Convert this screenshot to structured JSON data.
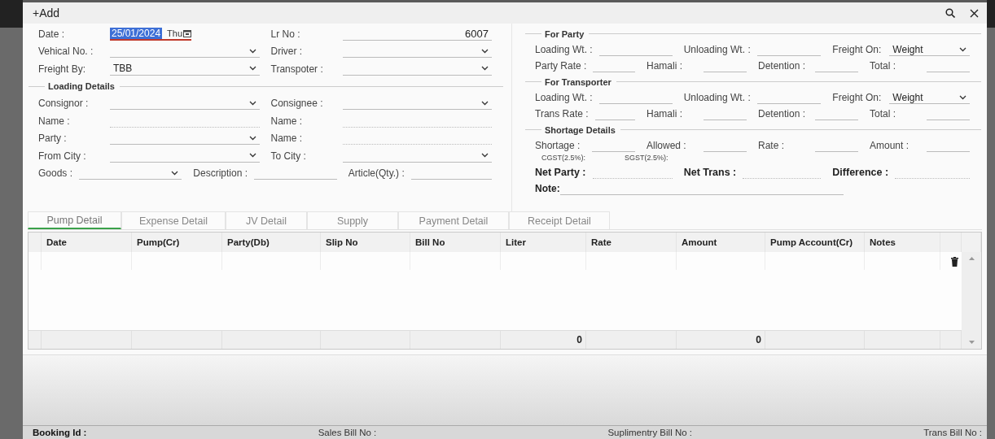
{
  "window": {
    "title": "+Add"
  },
  "left_form": [
    {
      "kind": "row",
      "fields": [
        {
          "label": "Date :",
          "kind": "date",
          "value": "25/01/2024",
          "day": "Thu",
          "text_selected": true
        },
        {
          "label": "Lr No :",
          "kind": "line",
          "value": "6007"
        }
      ]
    },
    {
      "kind": "row",
      "fields": [
        {
          "label": "Vehical No. :",
          "kind": "dropdown"
        },
        {
          "label": "Driver :",
          "kind": "dropdown"
        }
      ]
    },
    {
      "kind": "row",
      "fields": [
        {
          "label": "Freight By:",
          "kind": "dropdown",
          "value": "TBB"
        },
        {
          "label": "Transpoter :",
          "kind": "dropdown"
        }
      ]
    },
    {
      "kind": "section",
      "title": "Loading Details"
    },
    {
      "kind": "row",
      "fields": [
        {
          "label": "Consignor :",
          "kind": "dropdown"
        },
        {
          "label": "Consignee :",
          "kind": "dropdown"
        }
      ]
    },
    {
      "kind": "row",
      "fields": [
        {
          "label": "Name :",
          "kind": "dotted"
        },
        {
          "label": "Name :",
          "kind": "dotted"
        }
      ]
    },
    {
      "kind": "row",
      "fields": [
        {
          "label": "Party :",
          "kind": "dropdown"
        },
        {
          "label": "Name :",
          "kind": "dotted"
        }
      ]
    },
    {
      "kind": "row",
      "fields": [
        {
          "label": "From City :",
          "kind": "dropdown"
        },
        {
          "label": "To City :",
          "kind": "dropdown"
        }
      ]
    },
    {
      "kind": "row",
      "fields": [
        {
          "label": "Goods :",
          "kind": "dropdown"
        },
        {
          "label": "Description :",
          "kind": "line"
        },
        {
          "label": "Article(Qty.) :",
          "kind": "line"
        }
      ]
    }
  ],
  "right_form": [
    {
      "kind": "section",
      "title": "For Party"
    },
    {
      "kind": "row",
      "fields": [
        {
          "label": "Loading Wt. :",
          "kind": "line"
        },
        {
          "label": "Unloading Wt. :",
          "kind": "line"
        },
        {
          "label": "Freight On:",
          "kind": "dropdown",
          "value": "Weight"
        }
      ]
    },
    {
      "kind": "row",
      "fields": [
        {
          "label": "Party Rate :",
          "kind": "line"
        },
        {
          "label": "Hamali :",
          "kind": "line"
        },
        {
          "label": "Detention :",
          "kind": "line"
        },
        {
          "label": "Total :",
          "kind": "line"
        }
      ]
    },
    {
      "kind": "section",
      "title": "For Transporter"
    },
    {
      "kind": "row",
      "fields": [
        {
          "label": "Loading Wt. :",
          "kind": "line"
        },
        {
          "label": "Unloading Wt. :",
          "kind": "line"
        },
        {
          "label": "Freight On:",
          "kind": "dropdown",
          "value": "Weight"
        }
      ]
    },
    {
      "kind": "row",
      "fields": [
        {
          "label": "Trans Rate :",
          "kind": "line"
        },
        {
          "label": "Hamali :",
          "kind": "line"
        },
        {
          "label": "Detention :",
          "kind": "line"
        },
        {
          "label": "Total :",
          "kind": "line"
        }
      ]
    },
    {
      "kind": "section",
      "title": "Shortage Details"
    },
    {
      "kind": "row",
      "fields": [
        {
          "label": "Shortage :",
          "kind": "line"
        },
        {
          "label": "Allowed :",
          "kind": "line"
        },
        {
          "label": "Rate :",
          "kind": "line"
        },
        {
          "label": "Amount :",
          "kind": "line"
        }
      ]
    },
    {
      "kind": "tax",
      "fields": [
        {
          "label": "CGST(2.5%):"
        },
        {
          "label": "SGST(2.5%):"
        }
      ]
    },
    {
      "kind": "totals",
      "fields": [
        {
          "label": "Net Party :",
          "kind": "dotted"
        },
        {
          "label": "Net Trans :",
          "kind": "dotted"
        },
        {
          "label": "Difference :",
          "kind": "dotted"
        }
      ]
    },
    {
      "kind": "note",
      "fields": [
        {
          "label": "Note:",
          "kind": "line"
        }
      ]
    }
  ],
  "tabs": [
    {
      "label": "Pump Detail",
      "selected": true
    },
    {
      "label": "Expense Detail",
      "selected": false
    },
    {
      "label": "JV Detail",
      "selected": false
    },
    {
      "label": "Supply",
      "selected": false
    },
    {
      "label": "Payment Detail",
      "selected": false
    },
    {
      "label": "Receipt Detail",
      "selected": false
    }
  ],
  "table": {
    "columns": [
      {
        "label": "Date"
      },
      {
        "label": "Pump(Cr)"
      },
      {
        "label": "Party(Db)"
      },
      {
        "label": "Slip No"
      },
      {
        "label": "Bill No"
      },
      {
        "label": "Liter",
        "total": "0"
      },
      {
        "label": "Rate"
      },
      {
        "label": "Amount",
        "total": "0"
      },
      {
        "label": "Pump Account(Cr)"
      },
      {
        "label": "Notes"
      }
    ]
  },
  "status_bar": [
    {
      "label": "Booking Id :",
      "bold": true
    },
    {
      "label": "Sales Bill No :",
      "bold": false
    },
    {
      "label": "Suplimentry Bill No :",
      "bold": false
    },
    {
      "label": "Trans Bill No :",
      "bold": false
    }
  ]
}
